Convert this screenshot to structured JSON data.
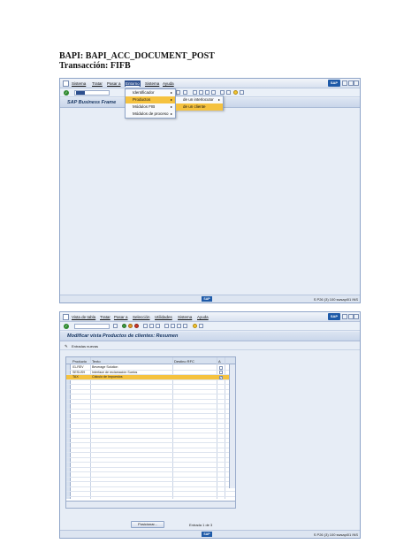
{
  "doc": {
    "bapi_line": "BAPI: BAPI_ACC_DOCUMENT_POST",
    "tx_line": "Transacción: FIFB"
  },
  "window1": {
    "menu": [
      "Sistema",
      "Tratar",
      "Pasar a",
      "Entorno",
      "Sistema",
      "Ayuda"
    ],
    "title": "SAP Business Frame",
    "dropdown": [
      "Identificador",
      "Productos",
      "Módulos FIB",
      "Módulos de proceso"
    ],
    "submenu": [
      "de un interlocutor",
      "de un cliente"
    ],
    "status": "S  P26 (3) 100  swsapi01  INS"
  },
  "window2": {
    "menu": [
      "Vista de tabla",
      "Tratar",
      "Pasar a",
      "Selección",
      "Utilidades",
      "Sistema",
      "Ayuda"
    ],
    "title": "Modificar vista Productos de clientes: Resumen",
    "toolbar_label": "Entradas nuevas",
    "columns": [
      "Producto",
      "Texto",
      "Destino RFC",
      "A"
    ],
    "rows": [
      {
        "product": "01-REV",
        "text": "Beverage Solution",
        "checked": false
      },
      {
        "product": "SESUS9",
        "text": "Interface de reclamación Suelos",
        "checked": false
      },
      {
        "product": "TAX",
        "text": "Cálculo de Impuestos",
        "checked": true
      }
    ],
    "position_button": "Posicionar...",
    "entry_label": "Entrada 1 de 3",
    "status": "S  P26 (3) 100  swsapi01  INS"
  }
}
